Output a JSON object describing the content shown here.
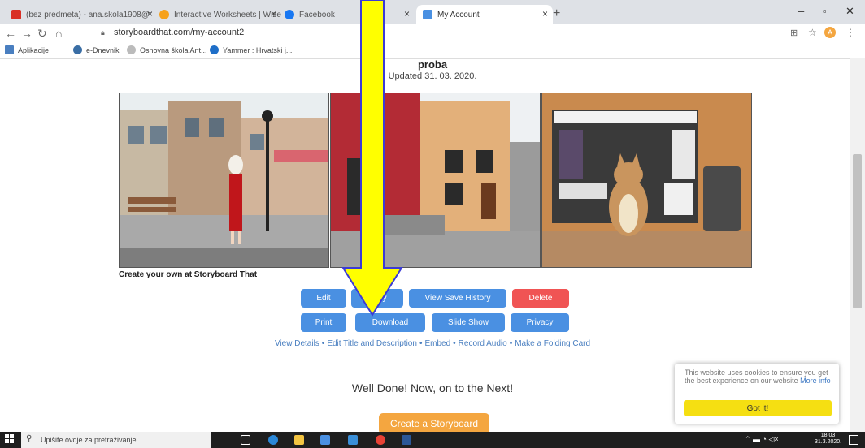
{
  "browser": {
    "tabs": [
      {
        "label": "(bez predmeta) - ana.skola1908@",
        "icon": "gmail-icon",
        "color": "#d93025"
      },
      {
        "label": "Interactive Worksheets | Wizer.m",
        "icon": "wizer-icon",
        "color": "#f6a11b"
      },
      {
        "label": "Facebook",
        "icon": "facebook-icon",
        "color": "#1877f2"
      },
      {
        "label": "My Account",
        "icon": "storyboard-icon",
        "color": "#4a90e2"
      }
    ],
    "url": "storyboardthat.com/my-account2",
    "profile_initial": "A",
    "bookmarks": [
      {
        "label": "Aplikacije",
        "icon": "apps-icon"
      },
      {
        "label": "e-Dnevnik",
        "icon": "edu-icon"
      },
      {
        "label": "Osnovna škola Ant...",
        "icon": "school-icon"
      },
      {
        "label": "Yammer : Hrvatski j...",
        "icon": "yammer-icon"
      }
    ]
  },
  "storyboard": {
    "title": "proba",
    "updated": "Updated 31. 03. 2020.",
    "credit": "Create your own at Storyboard That"
  },
  "actions": {
    "row1": [
      "Edit",
      "Copy",
      "View Save History",
      "Delete"
    ],
    "row2": [
      "Print",
      "Download",
      "Slide Show",
      "Privacy"
    ]
  },
  "links": [
    "View Details",
    "Edit Title and Description",
    "Embed",
    "Record Audio",
    "Make a Folding Card"
  ],
  "next": {
    "message": "Well Done! Now, on to the Next!",
    "create_button": "Create a Storyboard"
  },
  "cookie": {
    "text": "This website uses cookies to ensure you get the best experience on our website",
    "more_info": "More info",
    "button": "Got it!"
  },
  "taskbar": {
    "search_placeholder": "Upišite ovdje za pretraživanje",
    "time": "18:03",
    "date": "31.3.2020."
  },
  "colors": {
    "button_blue": "#4a90e2",
    "button_red": "#f05454",
    "create_orange": "#f4a640",
    "arrow_yellow": "#ffff00",
    "got_it_yellow": "#f5df12"
  }
}
